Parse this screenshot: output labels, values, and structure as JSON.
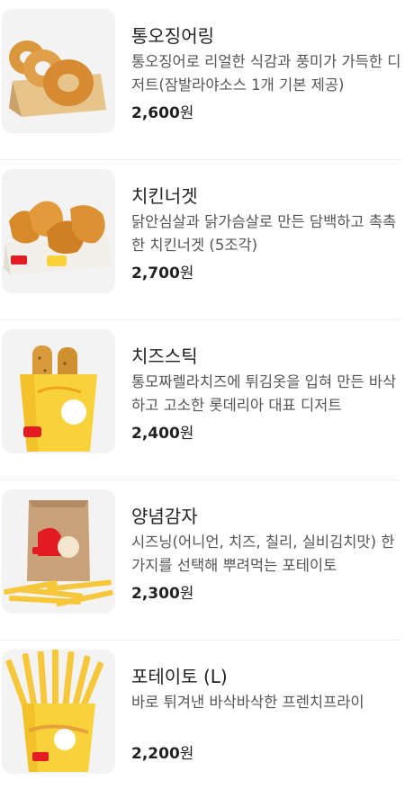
{
  "menu_items": [
    {
      "name": "통오징어링",
      "desc": "통오징어로 리얼한 식감과 풍미가 가득한 디저트(잠발라야소스 1개 기본 제공)",
      "price_num": "2,600",
      "price_unit": "원",
      "image": "squid-rings-icon"
    },
    {
      "name": "치킨너겟",
      "desc": "닭안심살과 닭가슴살로 만든 담백하고 촉촉한 치킨너겟 (5조각)",
      "price_num": "2,700",
      "price_unit": "원",
      "image": "chicken-nuggets-icon"
    },
    {
      "name": "치즈스틱",
      "desc": "통모짜렐라치즈에 튀김옷을 입혀 만든 바삭하고 고소한 롯데리아 대표 디저트",
      "price_num": "2,400",
      "price_unit": "원",
      "image": "cheese-sticks-icon"
    },
    {
      "name": "양념감자",
      "desc": "시즈닝(어니언, 치즈, 칠리, 실비김치맛) 한가지를 선택해 뿌려먹는 포테이토",
      "price_num": "2,300",
      "price_unit": "원",
      "image": "seasoned-fries-icon"
    },
    {
      "name": "포테이토 (L)",
      "desc": "바로 튀겨낸 바삭바삭한 프렌치프라이",
      "price_num": "2,200",
      "price_unit": "원",
      "image": "french-fries-icon"
    }
  ],
  "colors": {
    "accent_red": "#e31b23",
    "fry_yellow": "#f6c73a",
    "fried_brown": "#d88a2a",
    "box_yellow": "#f8d23a"
  }
}
